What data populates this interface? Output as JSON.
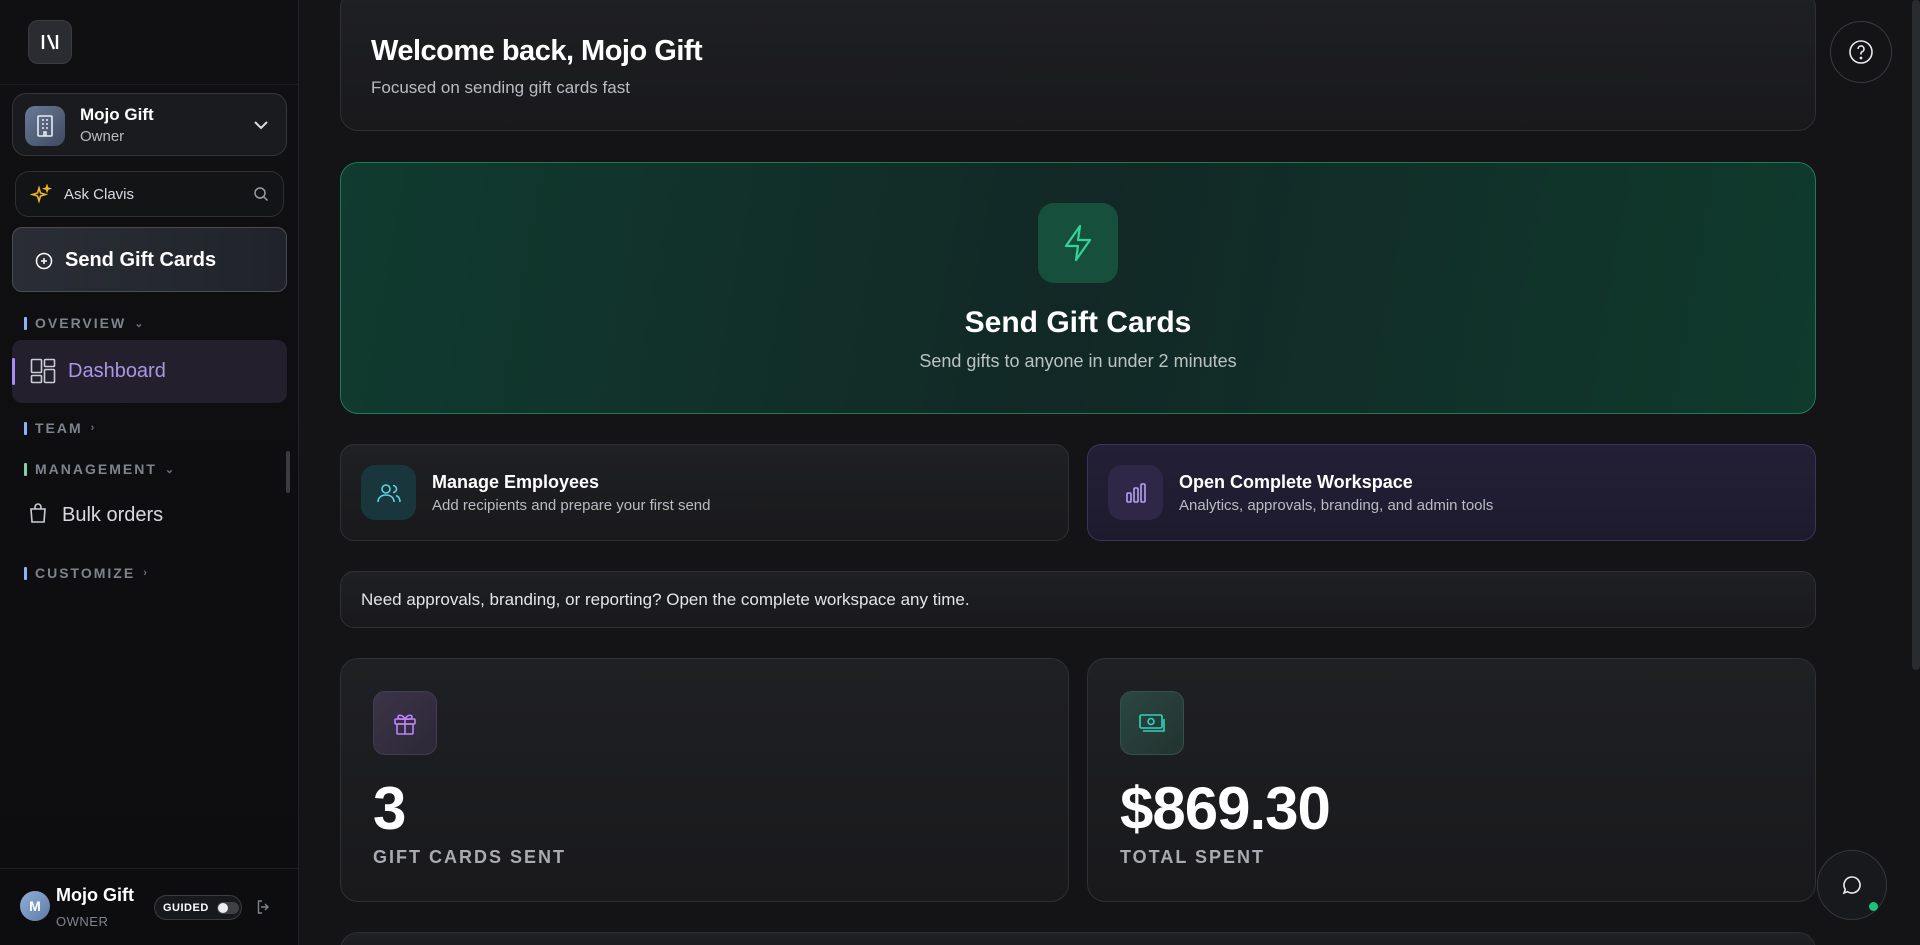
{
  "sidebar": {
    "logo_icon": "logo-icon",
    "org": {
      "name": "Mojo Gift",
      "role": "Owner",
      "icon": "building-icon"
    },
    "ask": {
      "label": "Ask Clavis",
      "icon": "sparkle-icon"
    },
    "send_button": {
      "label": "Send Gift Cards",
      "icon": "plus-circle-icon"
    },
    "sections": [
      {
        "label": "OVERVIEW",
        "color": "#8ab4f8"
      },
      {
        "label": "TEAM",
        "color": "#8ab4f8"
      },
      {
        "label": "MANAGEMENT",
        "color": "#7dd3a8"
      },
      {
        "label": "CUSTOMIZE",
        "color": "#8ab4f8"
      }
    ],
    "dashboard": {
      "label": "Dashboard",
      "icon": "layout-icon"
    },
    "bulk_orders": {
      "label": "Bulk orders",
      "icon": "bag-icon"
    },
    "user": {
      "initial": "M",
      "name": "Mojo Gift",
      "role": "OWNER",
      "guided_label": "GUIDED",
      "guided_on": false
    }
  },
  "main": {
    "welcome": {
      "title": "Welcome back, Mojo Gift",
      "subtitle": "Focused on sending gift cards fast"
    },
    "hero": {
      "title": "Send Gift Cards",
      "subtitle": "Send gifts to anyone in under 2 minutes",
      "icon": "lightning-icon",
      "accent": "#34d399"
    },
    "quick_actions": [
      {
        "title": "Manage Employees",
        "subtitle": "Add recipients and prepare your first send",
        "icon": "users-icon"
      },
      {
        "title": "Open Complete Workspace",
        "subtitle": "Analytics, approvals, branding, and admin tools",
        "icon": "bar-chart-icon"
      }
    ],
    "note": "Need approvals, branding, or reporting? Open the complete workspace any time.",
    "stats": [
      {
        "value": "3",
        "label": "GIFT CARDS SENT",
        "icon": "gift-icon",
        "color": "#c084fc"
      },
      {
        "value": "$869.30",
        "label": "TOTAL SPENT",
        "icon": "money-icon",
        "color": "#2dd4bf"
      }
    ]
  }
}
